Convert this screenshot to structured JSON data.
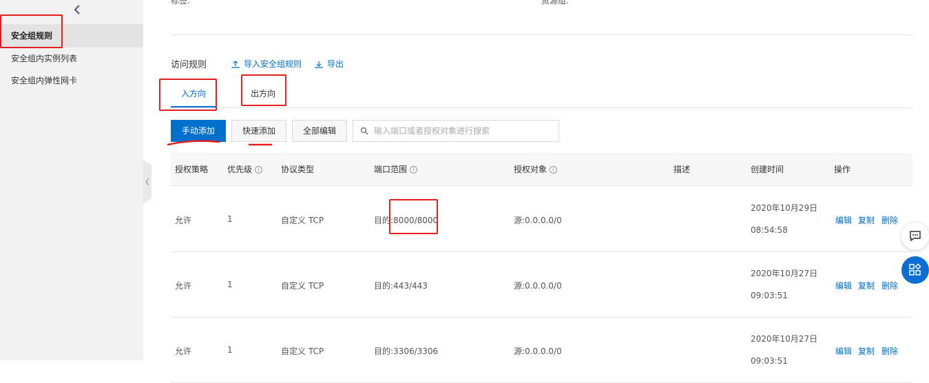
{
  "sidebar": {
    "items": [
      {
        "label": "安全组规则",
        "active": true
      },
      {
        "label": "安全组内实例列表",
        "active": false
      },
      {
        "label": "安全组内弹性网卡",
        "active": false
      }
    ]
  },
  "meta": {
    "tag_label": "标签:",
    "resource_group_label": "资源组:"
  },
  "rules": {
    "title": "访问规则",
    "import_label": "导入安全组规则",
    "export_label": "导出"
  },
  "tabs": [
    {
      "label": "入方向",
      "active": true
    },
    {
      "label": "出方向",
      "active": false
    }
  ],
  "toolbar": {
    "manual_add": "手动添加",
    "quick_add": "快速添加",
    "edit_all": "全部编辑",
    "search_placeholder": "输入端口或者授权对象进行搜索"
  },
  "table": {
    "columns": [
      "授权策略",
      "优先级",
      "协议类型",
      "端口范围",
      "授权对象",
      "描述",
      "创建时间",
      "操作"
    ],
    "rows": [
      {
        "policy": "允许",
        "priority": "1",
        "protocol": "自定义 TCP",
        "port": "目的:8000/8000",
        "source": "源:0.0.0.0/0",
        "desc": "",
        "date": "2020年10月29日",
        "time": "08:54:58"
      },
      {
        "policy": "允许",
        "priority": "1",
        "protocol": "自定义 TCP",
        "port": "目的:443/443",
        "source": "源:0.0.0.0/0",
        "desc": "",
        "date": "2020年10月27日",
        "time": "09:03:51"
      },
      {
        "policy": "允许",
        "priority": "1",
        "protocol": "自定义 TCP",
        "port": "目的:3306/3306",
        "source": "源:0.0.0.0/0",
        "desc": "",
        "date": "2020年10月27日",
        "time": "09:03:51"
      }
    ],
    "actions": [
      "编辑",
      "复制",
      "删除"
    ]
  },
  "colors": {
    "accent": "#0070cc",
    "annotation": "#e41e1e",
    "sidebar_bg": "#f2f2f2"
  }
}
